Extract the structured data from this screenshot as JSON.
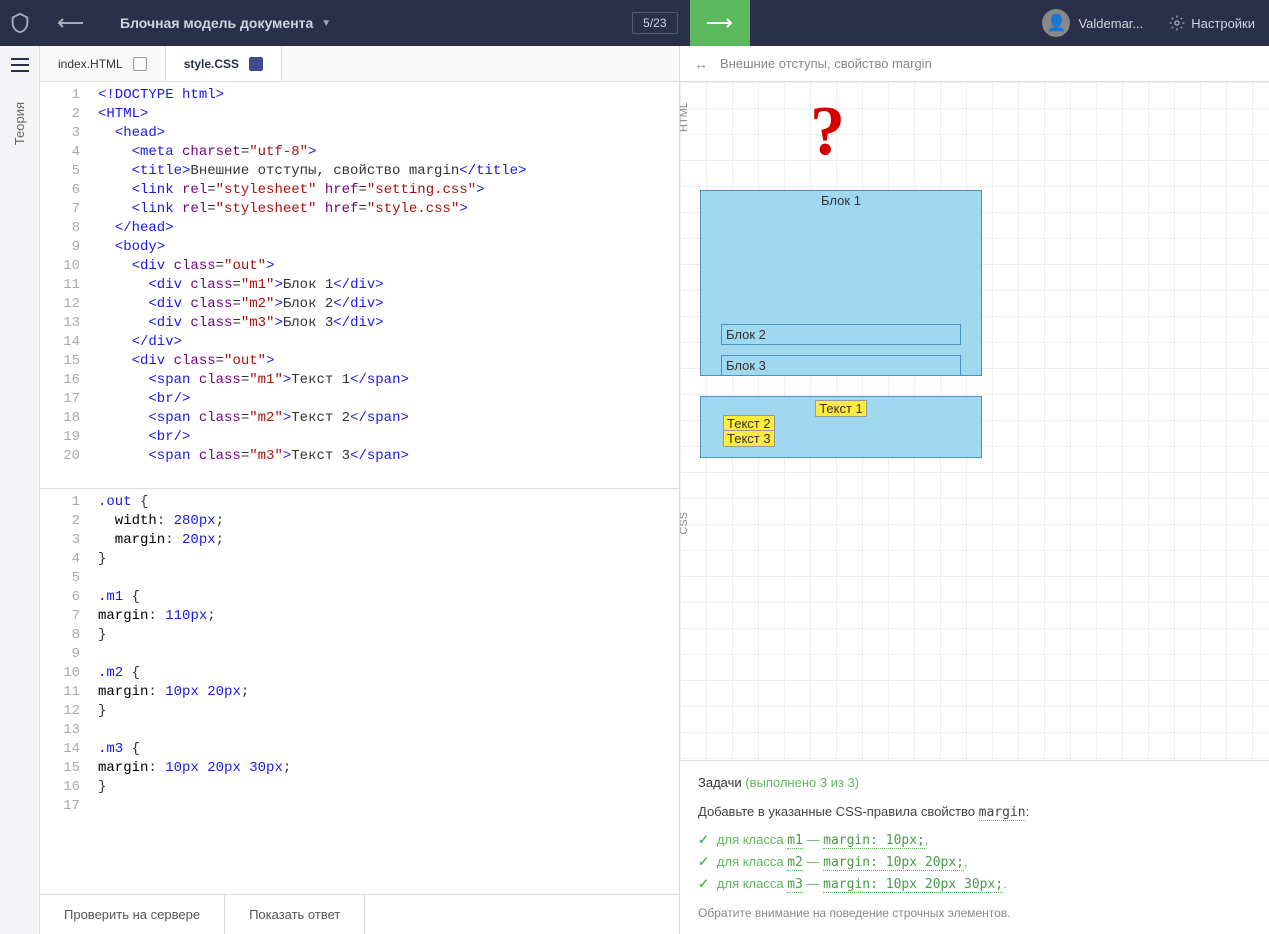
{
  "header": {
    "lesson_title": "Блочная модель документа",
    "counter": "5/23",
    "username": "Valdemar...",
    "settings": "Настройки"
  },
  "sidebar": {
    "theory": "Теория"
  },
  "tabs": {
    "html": "index.HTML",
    "css": "style.CSS"
  },
  "html_lines": [
    "1",
    "2",
    "3",
    "4",
    "5",
    "6",
    "7",
    "8",
    "9",
    "10",
    "11",
    "12",
    "13",
    "14",
    "15",
    "16",
    "17",
    "18",
    "19",
    "20"
  ],
  "html_code": {
    "l1a": "<!DOCTYPE html>",
    "l2": "<HTML>",
    "l3": "  <head>",
    "l4a": "    <meta ",
    "l4b": "charset",
    "l4c": "=",
    "l4d": "\"utf-8\"",
    "l4e": ">",
    "l5a": "    <title>",
    "l5b": "Внешние отступы, свойство margin",
    "l5c": "</title>",
    "l6a": "    <link ",
    "l6b": "rel",
    "l6c": "=",
    "l6d": "\"stylesheet\"",
    "l6e": " href",
    "l6f": "=",
    "l6g": "\"setting.css\"",
    "l6h": ">",
    "l7a": "    <link ",
    "l7b": "rel",
    "l7c": "=",
    "l7d": "\"stylesheet\"",
    "l7e": " href",
    "l7f": "=",
    "l7g": "\"style.css\"",
    "l7h": ">",
    "l8": "  </head>",
    "l9": "  <body>",
    "l10a": "    <div ",
    "l10b": "class",
    "l10c": "=",
    "l10d": "\"out\"",
    "l10e": ">",
    "l11a": "      <div ",
    "l11b": "class",
    "l11c": "=",
    "l11d": "\"m1\"",
    "l11e": ">",
    "l11f": "Блок 1",
    "l11g": "</div>",
    "l12a": "      <div ",
    "l12b": "class",
    "l12c": "=",
    "l12d": "\"m2\"",
    "l12e": ">",
    "l12f": "Блок 2",
    "l12g": "</div>",
    "l13a": "      <div ",
    "l13b": "class",
    "l13c": "=",
    "l13d": "\"m3\"",
    "l13e": ">",
    "l13f": "Блок 3",
    "l13g": "</div>",
    "l14": "    </div>",
    "l15a": "    <div ",
    "l15b": "class",
    "l15c": "=",
    "l15d": "\"out\"",
    "l15e": ">",
    "l16a": "      <span ",
    "l16b": "class",
    "l16c": "=",
    "l16d": "\"m1\"",
    "l16e": ">",
    "l16f": "Текст 1",
    "l16g": "</span>",
    "l17": "      <br/>",
    "l18a": "      <span ",
    "l18b": "class",
    "l18c": "=",
    "l18d": "\"m2\"",
    "l18e": ">",
    "l18f": "Текст 2",
    "l18g": "</span>",
    "l19": "      <br/>",
    "l20a": "      <span ",
    "l20b": "class",
    "l20c": "=",
    "l20d": "\"m3\"",
    "l20e": ">",
    "l20f": "Текст 3",
    "l20g": "</span>"
  },
  "css_lines": [
    "1",
    "2",
    "3",
    "4",
    "5",
    "6",
    "7",
    "8",
    "9",
    "10",
    "11",
    "12",
    "13",
    "14",
    "15",
    "16",
    "17"
  ],
  "css_code": {
    "l1": ".out {",
    "l2": "  width: 280px;",
    "l3": "  margin: 20px;",
    "l4": "}",
    "l5": "",
    "l6": ".m1 {",
    "l7": "margin: 110px;",
    "l8": "}",
    "l9": "",
    "l10": ".m2 {",
    "l11": "margin: 10px 20px;",
    "l12": "}",
    "l13": "",
    "l14": ".m3 {",
    "l15": "margin: 10px 20px 30px;",
    "l16": "}",
    "l17": ""
  },
  "css_tokens": {
    "s1": ".out",
    "b1": " {",
    "p1": "  width",
    "c1": ": ",
    "v1": "280px",
    "e1": ";",
    "p2": "  margin",
    "v2": "20px",
    "s2": ".m1",
    "p3": "margin",
    "v3": "110px",
    "s3": ".m2",
    "v4": "10px 20px",
    "s4": ".m3",
    "v5": "10px 20px 30px",
    "cb": "}"
  },
  "footer": {
    "check": "Проверить на сервере",
    "answer": "Показать ответ"
  },
  "preview": {
    "title": "Внешние отступы, свойство margin",
    "html_label": "HTML",
    "css_label": "CSS",
    "annotation": "?",
    "block1": "Блок 1",
    "block2": "Блок 2",
    "block3": "Блок 3",
    "text1": "Текст 1",
    "text2": "Текст 2",
    "text3": "Текст 3"
  },
  "tasks": {
    "label": "Задачи",
    "progress": "(выполнено 3 из 3)",
    "desc_a": "Добавьте в указанные CSS-правила свойство ",
    "desc_b": "margin",
    "desc_c": ":",
    "t1a": "для класса ",
    "t1b": "m1",
    "t1c": " — ",
    "t1d": "margin: 10px;",
    "t1e": ",",
    "t2a": "для класса ",
    "t2b": "m2",
    "t2c": " — ",
    "t2d": "margin: 10px 20px;",
    "t2e": ",",
    "t3a": "для класса ",
    "t3b": "m3",
    "t3c": " — ",
    "t3d": "margin: 10px 20px 30px;",
    "t3e": ".",
    "note": "Обратите внимание на поведение строчных элементов."
  }
}
